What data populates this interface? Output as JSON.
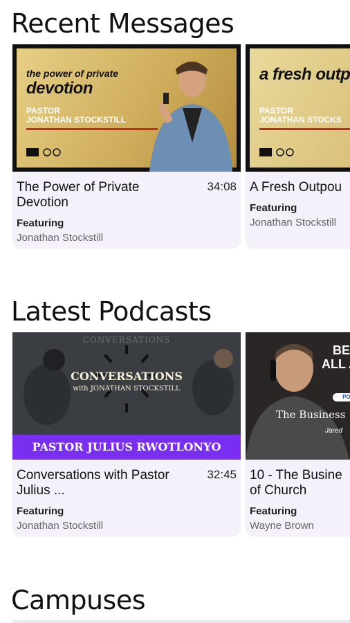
{
  "sections": {
    "recent_messages": "Recent Messages",
    "latest_podcasts": "Latest Podcasts",
    "campuses": "Campuses"
  },
  "messages": [
    {
      "thumb_small": "the power of private",
      "thumb_big": "devotion",
      "thumb_pastor_1": "PASTOR",
      "thumb_pastor_2": "JONATHAN STOCKSTILL",
      "title": "The Power of Private Devotion",
      "duration": "34:08",
      "featuring": "Featuring",
      "speaker": "Jonathan Stockstill"
    },
    {
      "thumb_small": "",
      "thumb_big": "a fresh outpourin",
      "thumb_pastor_1": "PASTOR",
      "thumb_pastor_2": "JONATHAN STOCKS",
      "title": "A Fresh Outpou",
      "featuring": "Featuring",
      "speaker": "Jonathan Stockstill"
    }
  ],
  "podcasts": [
    {
      "thumb_ghost": "CONVERSATIONS",
      "thumb_main": "CONVERSATIONS",
      "thumb_sub": "with JONATHAN STOCKSTILL",
      "thumb_band": "PASTOR JULIUS RWOTLONYO",
      "title": "Conversations with Pastor Julius ...",
      "duration": "32:45",
      "featuring": "Featuring",
      "speaker": "Jonathan Stockstill"
    },
    {
      "thumb_bet": "BET",
      "thumb_bet2": "ALL A",
      "thumb_pill": "PO",
      "thumb_biz": "The Business",
      "thumb_jared": "Jared",
      "title": "10 - The Busine of Church",
      "featuring": "Featuring",
      "speaker": "Wayne Brown"
    }
  ],
  "colors": {
    "card_bg": "#f4f1fb",
    "podcast_band": "#7a2ff0",
    "gold": "#cfae5c"
  }
}
